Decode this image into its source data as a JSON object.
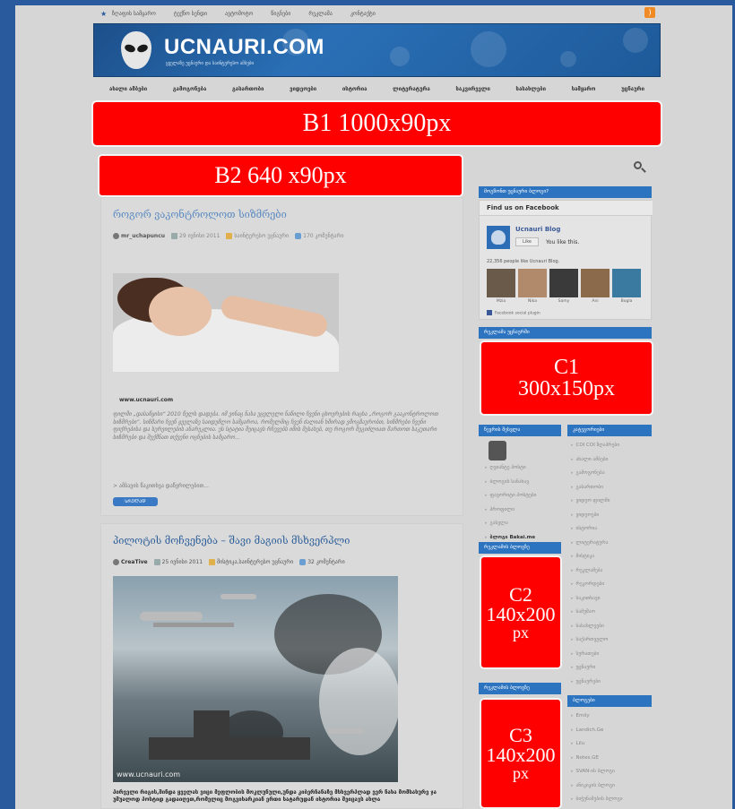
{
  "topnav": {
    "links": [
      "ზღაფის სამყარო",
      "ტექნო სენდი",
      "ავტომოტო",
      "წიგნები",
      "რეკლამა",
      "კონტაქტი"
    ]
  },
  "header": {
    "brand": "UCNAURI.COM",
    "tagline": "ყველაზე უცნაური და საინტერესო ამბები"
  },
  "mainnav": {
    "items": [
      "ახალი ამბები",
      "გამოგონება",
      "გასართობი",
      "ვიდეოები",
      "ისტორია",
      "ლიტერატურა",
      "საკვირველი",
      "სასახლები",
      "სამყარო",
      "უცნაური"
    ]
  },
  "ads": {
    "b1": "B1  1000x90px",
    "b2": "B2   640 x90px",
    "c1_line1": "C1",
    "c1_line2": "300x150px",
    "c2_line1": "C2",
    "c2_line2": "140x200",
    "c2_line3": "px",
    "c3_line1": "C3",
    "c3_line2": "140x200",
    "c3_line3": "px"
  },
  "post1": {
    "title": "როგორ ვაკონტროლოთ სიზმრები",
    "author": "mr_uchapuncu",
    "date": "29 ივნისი 2011",
    "category": "საინტერესო უცნაური",
    "comments": "170 კომენტარი",
    "caption": "www.ucnauri.com",
    "excerpt": "ფილმი „დასაწყისი“ 2010 წელს დადება. იმ ვინაც ნახა უცვლელი ნაწილი ჩვენი ცხოვრების რაცხა „როგორ გააკონტროლოთ სიზმრები“. სიზმარი ჩვენ ყველაზე საიდუმლო სამყაროა, რომელშიც ჩვენ ძალიან ხშირად ვმოგზაურობთ, სიზმრები ჩვენი ფიქრებისა და სურვილების ანარეკლია. ეს სტატია შეიცავს რჩევებს იმის შესახებ, თუ როგორ შეგიძლიათ მართოთ საკუთარი სიზმრები და შექმნათ თქვენი ოცნების სამყარო...",
    "more_link": "> ამბავის წაკითხვა დაწვრილებით...",
    "more_button": "ᲡᲠᲣᲚᲐᲓ"
  },
  "post2": {
    "title": "პილოტის მოჩვენება – შავი მაგიის მსხვერპლი",
    "author": "CreaTive",
    "date": "25 ივნისი 2011",
    "category": "მისტიკა,საინტერესო უცნაური",
    "comments": "32 კომენტარი",
    "watermark": "www.ucnauri.com",
    "excerpt": "პირველი რიგის,შინდა ყველას ვიცი მეფლობის მოკლუნული,უნდა კიბერჩანაზე მსხვერპლად ვერ ნახა მომსახურე ჯა უშუალოდ პოსტიდ გადაიღეთ,რომელიც მოგვიხარკიან ერთი სატარუდან ისტორია შეიცავს ახლა"
  },
  "sidebar": {
    "facebook_title": "მოგწონთ უცნაური ბლოგი?",
    "fb_find": "Find us on Facebook",
    "fb_name": "Ucnauri Blog",
    "fb_like": "Like",
    "fb_you_like": "You like this.",
    "fb_count": "22,356 people like Ucnauri Blog.",
    "fb_faces": [
      "Mzia",
      "Nika",
      "Samy",
      "Ani",
      "Bogla"
    ],
    "fb_plugin": "Facebook social plugin",
    "ad1_title": "რეკლამა უცნაურში",
    "friends_title": "წევრის შესვლა",
    "friends": [
      "ღვიანტე პოსტი",
      "ბლოგის სანახავ",
      "ფავორიტი პოსტები",
      "პროფილი",
      "გასვლა",
      "ბლოგი Bakai.me"
    ],
    "friends_strong_index": 5,
    "categories_title": "კატეგორიები",
    "categories": [
      "COI COI ზღაპრები",
      "ახალი ამბები",
      "გამოგონება",
      "გასართობი",
      "ვიდეო ფილმი",
      "ვიდეოები",
      "ისტორია",
      "ლიტერატურა",
      "მისტიკა",
      "რეკლამება",
      "რეკორდები",
      "საკითხავი",
      "სამუშაო",
      "სასახლეები",
      "საქართველო",
      "სურათები",
      "უცნაური",
      "უცნაურები"
    ],
    "ad2_title": "რეკლამის ბლოგზე",
    "ad3_title": "რეკლამის ბლოგზე",
    "blogs_title": "ბლოგები",
    "blogs": [
      "Emily",
      "Landich.Ge",
      "Lilu",
      "Notes.GE",
      "SVAN-ის ბლოგი",
      "ანიკიკის ბლოგი",
      "ბიჭუნამების ბლოგი"
    ]
  }
}
